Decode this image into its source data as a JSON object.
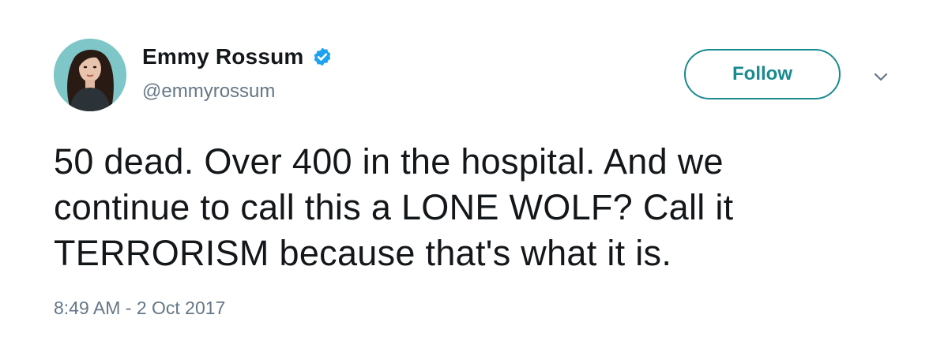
{
  "author": {
    "display_name": "Emmy Rossum",
    "handle": "@emmyrossum",
    "verified": true
  },
  "actions": {
    "follow_label": "Follow"
  },
  "tweet": {
    "lines": [
      "50 dead. Over 400 in the hospital. And we",
      "continue to call this a LONE WOLF? Call it",
      "TERRORISM because that's what it is."
    ],
    "timestamp": "8:49 AM - 2 Oct 2017"
  },
  "icons": {
    "verified": "verified-badge-icon",
    "more": "chevron-down-icon"
  },
  "colors": {
    "text": "#14171a",
    "secondary": "#657786",
    "follow_accent": "#1a8a8f",
    "verified_badge": "#1da1f2"
  }
}
